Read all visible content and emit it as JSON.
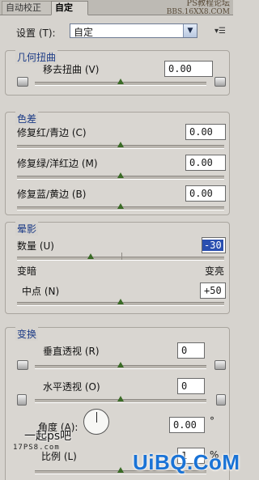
{
  "tabs": [
    {
      "label": "自动校正"
    },
    {
      "label": "自定"
    }
  ],
  "watermark_top": {
    "line1": "PS教程论坛",
    "line2": "BBS.16XX8.COM"
  },
  "settings": {
    "label": "设置 (T):",
    "value": "自定"
  },
  "geometric": {
    "title": "几何扭曲",
    "remove_distortion": {
      "label": "移去扭曲 (V)",
      "value": "0.00",
      "slider": 0.5
    }
  },
  "chromatic": {
    "title": "色差",
    "red_cyan": {
      "label": "修复红/青边 (C)",
      "value": "0.00",
      "slider": 0.5
    },
    "green_magenta": {
      "label": "修复绿/洋红边 (M)",
      "value": "0.00",
      "slider": 0.5
    },
    "blue_yellow": {
      "label": "修复蓝/黄边 (B)",
      "value": "0.00",
      "slider": 0.5
    }
  },
  "vignette": {
    "title": "晕影",
    "amount": {
      "label": "数量 (U)",
      "value": "-30",
      "slider": 0.35
    },
    "darken_label": "变暗",
    "lighten_label": "变亮",
    "midpoint": {
      "label": "中点 (N)",
      "value": "+50",
      "slider": 0.5
    }
  },
  "transform": {
    "title": "变换",
    "vertical": {
      "label": "垂直透视 (R)",
      "value": "0",
      "slider": 0.5
    },
    "horizontal": {
      "label": "水平透视 (O)",
      "value": "0",
      "slider": 0.5
    },
    "angle": {
      "label": "角度 (A):",
      "value": "0.00",
      "unit": "°"
    },
    "scale": {
      "label": "比例 (L)",
      "value": "1",
      "unit": "%"
    }
  },
  "watermark_bottom": {
    "text": "一起ps吧",
    "url": "17PS8.com",
    "brand": "UiBQ.CoM"
  }
}
